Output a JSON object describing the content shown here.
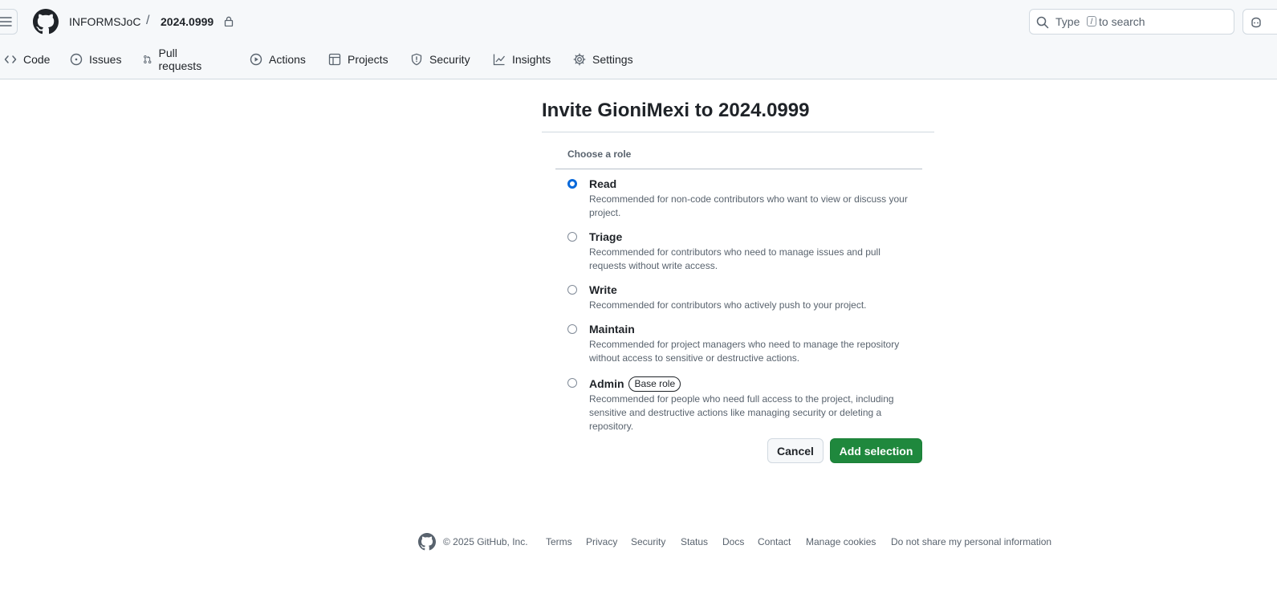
{
  "header": {
    "owner": "INFORMSJoC",
    "separator": "/",
    "repo": "2024.0999",
    "search_prefix": "Type",
    "search_key": "/",
    "search_suffix": "to search"
  },
  "tabs": [
    {
      "label": "Code",
      "icon": "code-icon"
    },
    {
      "label": "Issues",
      "icon": "issue-icon"
    },
    {
      "label": "Pull requests",
      "icon": "pull-request-icon"
    },
    {
      "label": "Actions",
      "icon": "play-icon"
    },
    {
      "label": "Projects",
      "icon": "table-icon"
    },
    {
      "label": "Security",
      "icon": "shield-icon"
    },
    {
      "label": "Insights",
      "icon": "graph-icon"
    },
    {
      "label": "Settings",
      "icon": "gear-icon"
    }
  ],
  "main": {
    "title": "Invite GioniMexi to 2024.0999",
    "choose_label": "Choose a role",
    "selected_role": "Read",
    "roles": [
      {
        "name": "Read",
        "description": "Recommended for non-code contributors who want to view or discuss your project."
      },
      {
        "name": "Triage",
        "description": "Recommended for contributors who need to manage issues and pull requests without write access."
      },
      {
        "name": "Write",
        "description": "Recommended for contributors who actively push to your project."
      },
      {
        "name": "Maintain",
        "description": "Recommended for project managers who need to manage the repository without access to sensitive or destructive actions."
      },
      {
        "name": "Admin",
        "badge": "Base role",
        "description": "Recommended for people who need full access to the project, including sensitive and destructive actions like managing security or deleting a repository."
      }
    ],
    "cancel_label": "Cancel",
    "add_label": "Add selection"
  },
  "footer": {
    "copyright": "© 2025 GitHub, Inc.",
    "links": [
      "Terms",
      "Privacy",
      "Security",
      "Status",
      "Docs",
      "Contact",
      "Manage cookies",
      "Do not share my personal information"
    ]
  },
  "colors": {
    "accent": "#0969da",
    "primary_button": "#1f883d",
    "header_bg": "#f6f8fa"
  }
}
